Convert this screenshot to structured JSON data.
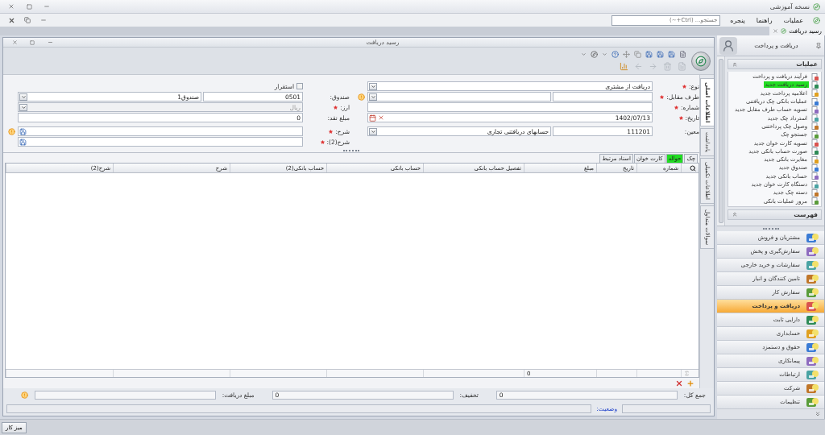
{
  "app": {
    "title": "نسخه آموزشی"
  },
  "menu": [
    {
      "label": "عملیات"
    },
    {
      "label": "راهنما"
    },
    {
      "label": "پنجره"
    }
  ],
  "search": {
    "placeholder": "جستجو... (Ctrl+~)"
  },
  "doc_tabs": [
    {
      "label": "رسید دریافت",
      "selected": true
    }
  ],
  "window": {
    "title": "رسید دریافت"
  },
  "side_tabs": [
    {
      "label": "اطلاعات اصلی",
      "selected": true
    },
    {
      "label": "یادداشت",
      "selected": false
    },
    {
      "label": "اطلاعات تکمیلی",
      "selected": false
    },
    {
      "label": "سوالات متداول",
      "selected": false
    }
  ],
  "form": {
    "right": [
      {
        "label": "نوع:",
        "required": true,
        "disabled": false,
        "hint_icon": false,
        "kind": "combo",
        "values": [
          "دریافت از مشتری"
        ]
      },
      {
        "label": "طرف مقابل:",
        "required": true,
        "disabled": false,
        "hint_icon": true,
        "kind": "pair"
      },
      {
        "label": "شماره:",
        "required": true,
        "disabled": false,
        "hint_icon": false,
        "kind": "text"
      },
      {
        "label": "تاریخ:",
        "required": true,
        "disabled": false,
        "hint_icon": false,
        "kind": "date",
        "values": [
          "1402/07/13"
        ]
      },
      {
        "label": "معین:",
        "required": false,
        "disabled": false,
        "hint_icon": false,
        "kind": "pair",
        "values": [
          "111201",
          "حسابهای دریافتنی تجاری"
        ]
      }
    ],
    "left_checkbox": {
      "label": "استقرار",
      "checked": false
    },
    "left": [
      {
        "label": "صندوق:",
        "required": false,
        "disabled": false,
        "hint_icon": false,
        "kind": "pair",
        "values": [
          "0501",
          "صندوق1"
        ]
      },
      {
        "label": "ارز:",
        "required": true,
        "disabled": true,
        "hint_icon": false,
        "kind": "combo",
        "values": [
          "ریال"
        ]
      },
      {
        "label": "مبلغ نقد:",
        "required": false,
        "disabled": false,
        "hint_icon": false,
        "kind": "text",
        "values": [
          "0"
        ]
      },
      {
        "label": "شرح:",
        "required": true,
        "disabled": false,
        "hint_icon": true,
        "kind": "memo"
      },
      {
        "label": "شرح(2):",
        "required": true,
        "disabled": false,
        "hint_icon": false,
        "kind": "memo"
      }
    ]
  },
  "detail_tabs": [
    {
      "label": "چک",
      "selected": false
    },
    {
      "label": "حواله",
      "selected": true
    },
    {
      "label": "کارت خوان",
      "selected": false
    },
    {
      "label": "اسناد مرتبط",
      "selected": false
    }
  ],
  "table": {
    "columns": [
      {
        "label": "شماره"
      },
      {
        "label": "تاریخ"
      },
      {
        "label": "مبلغ",
        "total": "0"
      },
      {
        "label": "تفصیل حساب بانکی"
      },
      {
        "label": "حساب بانکی"
      },
      {
        "label": "حساب بانکی(2)"
      },
      {
        "label": "شرح"
      },
      {
        "label": "شرح(2)"
      }
    ]
  },
  "totals": [
    {
      "label": "جمع کل:",
      "value": "0"
    },
    {
      "label": "تخفیف:",
      "value": "0"
    },
    {
      "label": "مبلغ دریافت:"
    }
  ],
  "status": {
    "label": "وضعیت:"
  },
  "sidebar": {
    "title": "دریافت و پرداخت",
    "sections": [
      {
        "title": "عملیات",
        "items": [
          {
            "label": "فرآیند دریافت و پرداخت",
            "selected": false
          },
          {
            "label": "رسید دریافت جدید",
            "selected": true
          },
          {
            "label": "اعلامیه پرداخت جدید",
            "selected": false
          },
          {
            "label": "عملیات بانکی چک دریافتنی",
            "selected": false
          },
          {
            "label": "تسویه حساب طرف مقابل جدید",
            "selected": false
          },
          {
            "label": "استرداد چک جدید",
            "selected": false
          },
          {
            "label": "وصول چک پرداختنی",
            "selected": false
          },
          {
            "label": "جستجو چک",
            "selected": false
          },
          {
            "label": "تسویه کارت خوان جدید",
            "selected": false
          },
          {
            "label": "صورت حساب بانکی جدید",
            "selected": false
          },
          {
            "label": "مغایرت بانکی جدید",
            "selected": false
          },
          {
            "label": "صندوق جدید",
            "selected": false
          },
          {
            "label": "حساب بانکی جدید",
            "selected": false
          },
          {
            "label": "دستگاه کارت خوان جدید",
            "selected": false
          },
          {
            "label": "دسته چک جدید",
            "selected": false
          },
          {
            "label": "مرور عملیات بانکی",
            "selected": false
          }
        ]
      },
      {
        "title": "فهرست"
      }
    ],
    "modules": [
      {
        "label": "مشتریان و فروش",
        "selected": false
      },
      {
        "label": "سفارش‌گیری و پخش",
        "selected": false
      },
      {
        "label": "سفارشات و خرید خارجی",
        "selected": false
      },
      {
        "label": "تامین کنندگان و انبار",
        "selected": false
      },
      {
        "label": "سفارش کار",
        "selected": false
      },
      {
        "label": "دریافت و پرداخت",
        "selected": true
      },
      {
        "label": "دارایی ثابت",
        "selected": false
      },
      {
        "label": "حسابداری",
        "selected": false
      },
      {
        "label": "حقوق و دستمزد",
        "selected": false
      },
      {
        "label": "پیمانکاری",
        "selected": false
      },
      {
        "label": "ارتباطات",
        "selected": false
      },
      {
        "label": "شرکت",
        "selected": false
      },
      {
        "label": "تنظیمات",
        "selected": false
      }
    ]
  },
  "taskbar": {
    "button": "میز کار"
  }
}
